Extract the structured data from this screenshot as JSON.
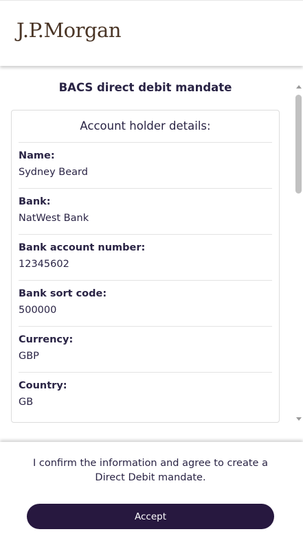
{
  "header": {
    "logo_text": "J.P.Morgan"
  },
  "main": {
    "title": "BACS direct debit mandate",
    "card": {
      "title": "Account holder details:",
      "fields": [
        {
          "label": "Name:",
          "value": "Sydney Beard"
        },
        {
          "label": "Bank:",
          "value": "NatWest Bank"
        },
        {
          "label": "Bank account number:",
          "value": "12345602"
        },
        {
          "label": "Bank sort code:",
          "value": "500000"
        },
        {
          "label": "Currency:",
          "value": "GBP"
        },
        {
          "label": "Country:",
          "value": "GB"
        }
      ]
    }
  },
  "footer": {
    "confirm_text": "I confirm the information and agree to create a Direct Debit mandate.",
    "accept_label": "Accept"
  },
  "colors": {
    "brand_logo": "#4a3526",
    "primary_button": "#27183f",
    "text": "#2a2445"
  }
}
